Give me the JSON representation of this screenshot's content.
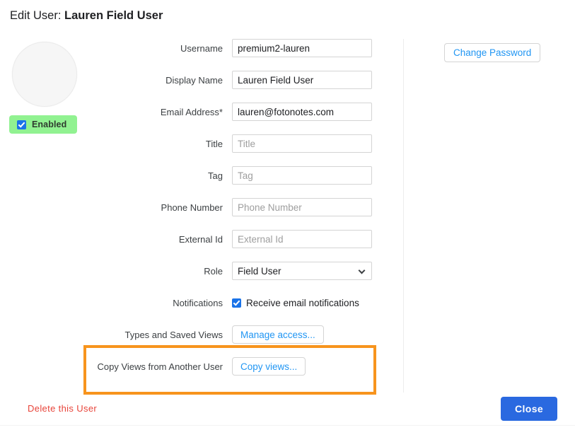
{
  "title": {
    "prefix": "Edit User:",
    "user_name": "Lauren Field User"
  },
  "avatar": {
    "name": "user-avatar"
  },
  "status_badge": {
    "label": "Enabled",
    "checked": true,
    "background_color": "#91f291"
  },
  "form": {
    "rows": [
      {
        "label": "Username",
        "type": "text",
        "value": "premium2-lauren",
        "placeholder": "Username"
      },
      {
        "label": "Display Name",
        "type": "text",
        "value": "Lauren Field User",
        "placeholder": "Display Name"
      },
      {
        "label": "Email Address*",
        "type": "text",
        "value": "lauren@fotonotes.com",
        "placeholder": "Email Address"
      },
      {
        "label": "Title",
        "type": "text",
        "value": "",
        "placeholder": "Title"
      },
      {
        "label": "Tag",
        "type": "text",
        "value": "",
        "placeholder": "Tag"
      },
      {
        "label": "Phone Number",
        "type": "text",
        "value": "",
        "placeholder": "Phone Number"
      },
      {
        "label": "External Id",
        "type": "text",
        "value": "",
        "placeholder": "External Id"
      },
      {
        "label": "Role",
        "type": "select",
        "value": "Field User"
      },
      {
        "label": "Notifications",
        "type": "checkbox",
        "value": "Receive email notifications",
        "checked": true
      },
      {
        "label": "Types and Saved Views",
        "type": "button",
        "value": "Manage access..."
      },
      {
        "label": "Copy Views from Another User",
        "type": "button",
        "value": "Copy views..."
      }
    ]
  },
  "highlight": {
    "color": "#f7941d",
    "targets": "Copy Views from Another User"
  },
  "right_panel": {
    "change_password_label": "Change Password"
  },
  "footer": {
    "delete_label": "Delete this User",
    "close_label": "Close",
    "close_color": "#2a69e0",
    "delete_color": "#e8443a"
  }
}
